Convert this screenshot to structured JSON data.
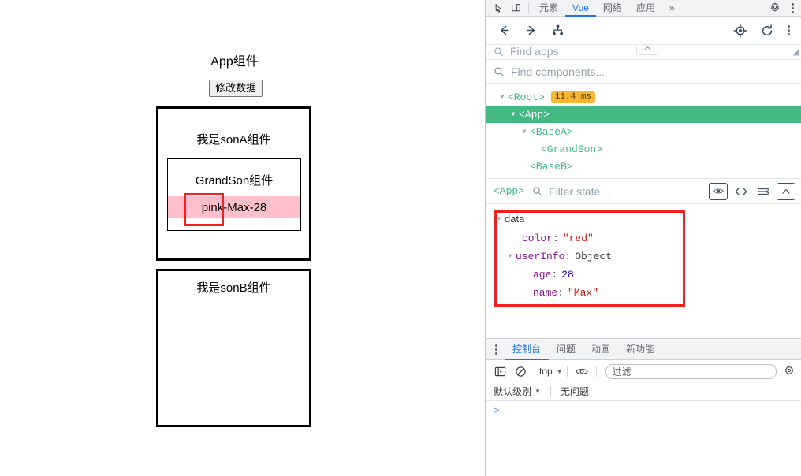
{
  "page": {
    "app_title": "App组件",
    "modify_button": "修改数据",
    "sonA_label": "我是sonA组件",
    "grandson_label": "GrandSon组件",
    "grandson_value": "pink-Max-28",
    "sonB_label": "我是sonB组件",
    "pink_color": "#ffc0cb",
    "annotation_color": "#f52020"
  },
  "devtools": {
    "tabs": [
      {
        "label": "元素",
        "active": false
      },
      {
        "label": "Vue",
        "active": true
      },
      {
        "label": "网络",
        "active": false
      },
      {
        "label": "应用",
        "active": false
      },
      {
        "label": "»",
        "active": false
      }
    ],
    "vue_panel": {
      "find_apps_placeholder": "Find apps",
      "find_components_placeholder": "Find components...",
      "tree": [
        {
          "label": "<Root>",
          "depth": 0,
          "arrow": "▼",
          "selected": false,
          "badge": "11.4 ms"
        },
        {
          "label": "<App>",
          "depth": 1,
          "arrow": "▼",
          "selected": true,
          "badge": ""
        },
        {
          "label": "<BaseA>",
          "depth": 2,
          "arrow": "▼",
          "selected": false,
          "badge": ""
        },
        {
          "label": "<GrandSon>",
          "depth": 3,
          "arrow": "",
          "selected": false,
          "badge": ""
        },
        {
          "label": "<BaseB>",
          "depth": 2,
          "arrow": "",
          "selected": false,
          "badge": ""
        }
      ],
      "state_bar": {
        "component": "<App>",
        "filter_placeholder": "Filter state..."
      },
      "state": {
        "group_label": "data",
        "rows": [
          {
            "indent": 1,
            "arrow": "",
            "key": "color",
            "value": "\"red\"",
            "type": "string"
          },
          {
            "indent": 0,
            "arrow": "▼",
            "key": "userInfo",
            "value": "Object",
            "type": "object"
          },
          {
            "indent": 2,
            "arrow": "",
            "key": "age",
            "value": "28",
            "type": "number"
          },
          {
            "indent": 2,
            "arrow": "",
            "key": "name",
            "value": "\"Max\"",
            "type": "string"
          }
        ]
      },
      "selected_color": "#42b883",
      "badge_color": "#f7b731"
    },
    "console": {
      "tabs": [
        {
          "label": "控制台",
          "active": true
        },
        {
          "label": "问题",
          "active": false
        },
        {
          "label": "动画",
          "active": false
        },
        {
          "label": "新功能",
          "active": false
        }
      ],
      "context": "top",
      "filter_placeholder": "过滤",
      "level": "默认级别",
      "issues": "无问题",
      "prompt": ">"
    }
  }
}
